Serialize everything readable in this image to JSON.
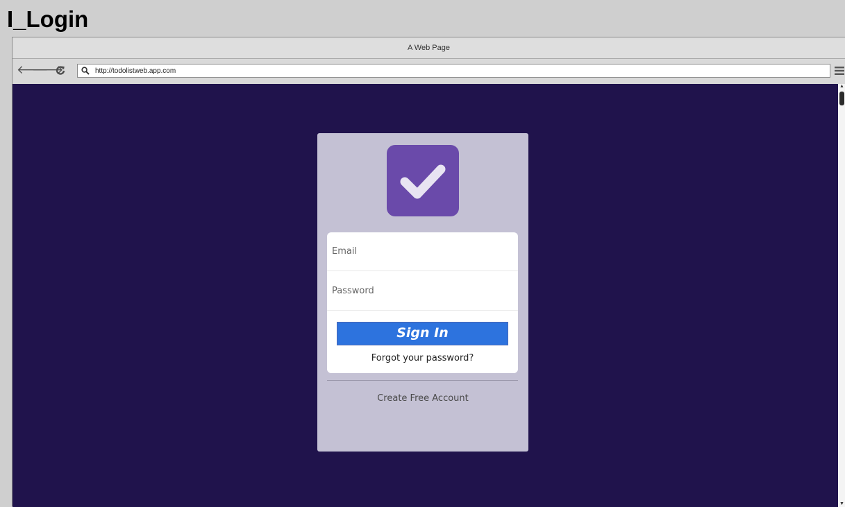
{
  "page": {
    "heading": "I_Login"
  },
  "browser": {
    "window_title": "A Web Page",
    "url": "http://todolistweb.app.com"
  },
  "icons": {
    "back": "arrow-left-icon",
    "forward": "arrow-right-icon",
    "reload": "reload-icon",
    "search": "search-icon",
    "menu": "hamburger-menu-icon",
    "logo": "checkmark-icon"
  },
  "login": {
    "email_placeholder": "Email",
    "password_placeholder": "Password",
    "signin_label": "Sign In",
    "forgot_label": "Forgot your password?",
    "create_label": "Create Free Account"
  },
  "colors": {
    "background": "#20134c",
    "card": "#c4c1d4",
    "logo": "#6a4aaa",
    "button": "#2d73de"
  }
}
